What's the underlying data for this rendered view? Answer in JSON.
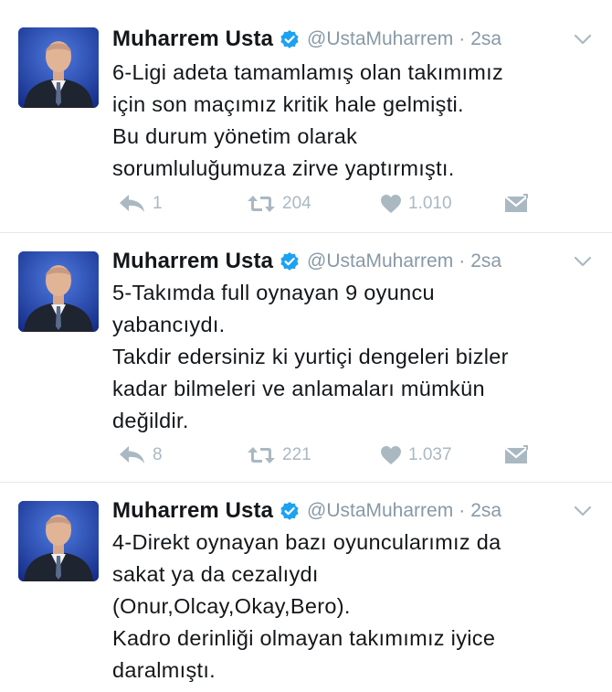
{
  "tweets": [
    {
      "author": "Muharrem Usta",
      "handle": "@UstaMuharrem",
      "separator": "·",
      "time": "2sa",
      "lines": [
        "6-Ligi adeta tamamlamış olan takımımız",
        "için son maçımız kritik hale gelmişti.",
        "Bu durum yönetim olarak",
        "sorumluluğumuza zirve yaptırmıştı."
      ],
      "replies": "1",
      "retweets": "204",
      "likes": "1.010",
      "avatar_icon": "profile-photo",
      "verified_icon": "verified-badge-icon"
    },
    {
      "author": "Muharrem Usta",
      "handle": "@UstaMuharrem",
      "separator": "·",
      "time": "2sa",
      "lines": [
        "5-Takımda full oynayan 9 oyuncu",
        "yabancıydı.",
        "Takdir edersiniz ki yurtiçi dengeleri bizler",
        "kadar bilmeleri ve anlamaları mümkün",
        "değildir."
      ],
      "replies": "8",
      "retweets": "221",
      "likes": "1.037",
      "avatar_icon": "profile-photo",
      "verified_icon": "verified-badge-icon"
    },
    {
      "author": "Muharrem Usta",
      "handle": "@UstaMuharrem",
      "separator": "·",
      "time": "2sa",
      "lines": [
        "4-Direkt oynayan bazı oyuncularımız da",
        "sakat ya da cezalıydı",
        "(Onur,Olcay,Okay,Bero).",
        "Kadro derinliği olmayan takımımız iyice",
        "daralmıştı."
      ],
      "avatar_icon": "profile-photo",
      "verified_icon": "verified-badge-icon"
    }
  ],
  "colors": {
    "text": "#14171a",
    "muted": "#8899a6",
    "icon": "#aab8c2",
    "verified": "#1da1f2",
    "divider": "#e1e8ed"
  }
}
